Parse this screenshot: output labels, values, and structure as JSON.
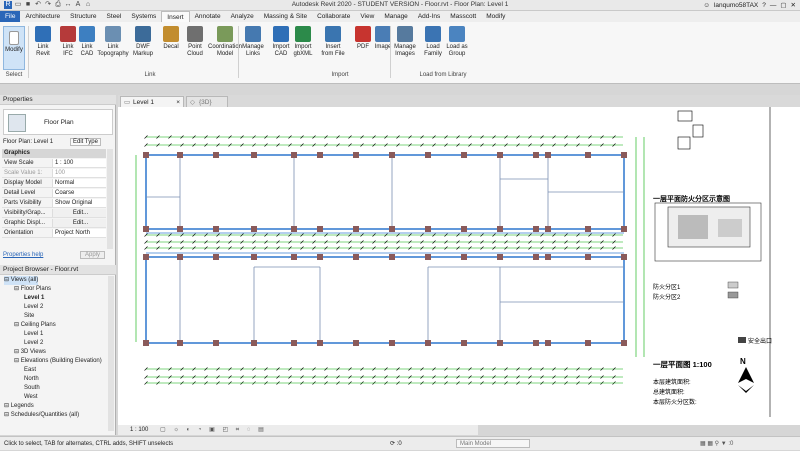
{
  "window": {
    "title": "Autodesk Revit 2020 - STUDENT VERSION - Floor.rvt - Floor Plan: Level 1",
    "user": "lanqumo58TAX"
  },
  "ribbon_tabs": [
    "File",
    "Architecture",
    "Structure",
    "Steel",
    "Systems",
    "Insert",
    "Annotate",
    "Analyze",
    "Massing & Site",
    "Collaborate",
    "View",
    "Manage",
    "Add-Ins",
    "Masscott",
    "Modify"
  ],
  "ribbon": {
    "modify": "Modify",
    "select_group": "Select",
    "buttons": [
      {
        "label": "Link\nRevit",
        "color": "#2f6fb7"
      },
      {
        "label": "Link\nIFC",
        "color": "#b53a3a"
      },
      {
        "label": "Link\nCAD",
        "color": "#3d7fc1"
      },
      {
        "label": "Link\nTopography",
        "color": "#6b8fb2"
      },
      {
        "label": "DWF\nMarkup",
        "color": "#3c6b99"
      },
      {
        "label": "Decal",
        "color": "#c28d2f"
      },
      {
        "label": "Point\nCloud",
        "color": "#6f6f6f"
      },
      {
        "label": "Coordination\nModel",
        "color": "#7a9a5a"
      },
      {
        "label": "Manage\nLinks",
        "color": "#4579b0"
      },
      {
        "label": "Import\nCAD",
        "color": "#2f6fb7"
      },
      {
        "label": "Import\ngbXML",
        "color": "#2c8a4a"
      },
      {
        "label": "Insert\nfrom File",
        "color": "#3a75b0"
      },
      {
        "label": "PDF",
        "color": "#c7342f"
      },
      {
        "label": "Image",
        "color": "#4a7db5"
      },
      {
        "label": "Manage\nImages",
        "color": "#567a9e"
      },
      {
        "label": "Load\nFamily",
        "color": "#3b74b3"
      },
      {
        "label": "Load as\nGroup",
        "color": "#4b84c0"
      }
    ],
    "groups": {
      "link": "Link",
      "import": "Import",
      "load": "Load from Library"
    }
  },
  "view_tabs": [
    {
      "label": "Level 1"
    },
    {
      "label": "{3D}"
    }
  ],
  "properties": {
    "title": "Properties",
    "type": "Floor Plan",
    "selector": "Floor Plan: Level 1",
    "edit_type": "Edit Type",
    "section": "Graphics",
    "rows": [
      {
        "k": "View Scale",
        "v": "1 : 100"
      },
      {
        "k": "Scale Value   1:",
        "v": "100"
      },
      {
        "k": "Display Model",
        "v": "Normal"
      },
      {
        "k": "Detail Level",
        "v": "Coarse"
      },
      {
        "k": "Parts Visibility",
        "v": "Show Original"
      },
      {
        "k": "Visibility/Grap...",
        "v": "Edit..."
      },
      {
        "k": "Graphic Displ...",
        "v": "Edit..."
      },
      {
        "k": "Orientation",
        "v": "Project North"
      }
    ],
    "help": "Properties help",
    "apply": "Apply"
  },
  "project_browser": {
    "title": "Project Browser - Floor.rvt",
    "items": [
      {
        "t": "Views (all)",
        "lvl": 0
      },
      {
        "t": "Floor Plans",
        "lvl": 1
      },
      {
        "t": "Level 1",
        "lvl": 2,
        "bold": true
      },
      {
        "t": "Level 2",
        "lvl": 2
      },
      {
        "t": "Site",
        "lvl": 2
      },
      {
        "t": "Ceiling Plans",
        "lvl": 1
      },
      {
        "t": "Level 1",
        "lvl": 2
      },
      {
        "t": "Level 2",
        "lvl": 2
      },
      {
        "t": "3D Views",
        "lvl": 1
      },
      {
        "t": "Elevations (Building Elevation)",
        "lvl": 1
      },
      {
        "t": "East",
        "lvl": 2
      },
      {
        "t": "North",
        "lvl": 2
      },
      {
        "t": "South",
        "lvl": 2
      },
      {
        "t": "West",
        "lvl": 2
      },
      {
        "t": "Legends",
        "lvl": 0
      },
      {
        "t": "Schedules/Quantities (all)",
        "lvl": 0
      }
    ]
  },
  "canvas": {
    "title_fire": "一层平面防火分区示意图",
    "title_plan": "一层平面图 1:100",
    "notes": [
      "本层建筑面积:",
      "总建筑面积:",
      "本层防火分区数:"
    ],
    "legend": [
      "防火分区1",
      "防火分区2"
    ],
    "exit_label": "安全出口"
  },
  "view_bar": {
    "scale": "1 : 100"
  },
  "status": {
    "hint": "Click to select, TAB for alternates, CTRL adds, SHIFT unselects",
    "model": "Main Model",
    "zero": ":0"
  }
}
